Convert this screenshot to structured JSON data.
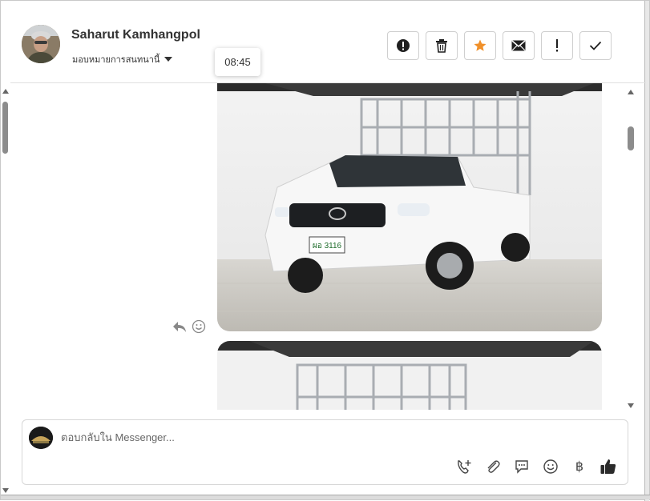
{
  "header": {
    "contact_name": "Saharut Kamhangpol",
    "assign_label": "มอบหมายการสนทนานี้",
    "tooltip_time": "08:45",
    "actions": [
      {
        "name": "report-spam",
        "icon": "exclamation-circle-icon"
      },
      {
        "name": "delete",
        "icon": "trash-icon"
      },
      {
        "name": "star",
        "icon": "star-icon",
        "color": "#f0902a"
      },
      {
        "name": "mark-unread",
        "icon": "envelope-icon"
      },
      {
        "name": "follow-up",
        "icon": "exclamation-icon"
      },
      {
        "name": "mark-done",
        "icon": "check-icon"
      }
    ]
  },
  "messages": {
    "items": [
      {
        "type": "image",
        "subject": "white pickup truck with cargo rack"
      },
      {
        "type": "image",
        "subject": "white pickup truck with cargo rack"
      }
    ],
    "tools": [
      {
        "icon": "reply-icon"
      },
      {
        "icon": "smiley-icon"
      }
    ],
    "plate_text": "ผอ 3116"
  },
  "composer": {
    "placeholder": "ตอบกลับใน Messenger...",
    "tools": [
      {
        "icon": "add-call-icon"
      },
      {
        "icon": "paperclip-icon"
      },
      {
        "icon": "saved-reply-icon"
      },
      {
        "icon": "emoji-icon"
      },
      {
        "icon": "baht-icon",
        "label": "฿"
      },
      {
        "icon": "thumbs-up-icon"
      }
    ]
  },
  "colors": {
    "accent_star": "#f0902a",
    "text": "#333333",
    "border": "#cfcfcf"
  }
}
